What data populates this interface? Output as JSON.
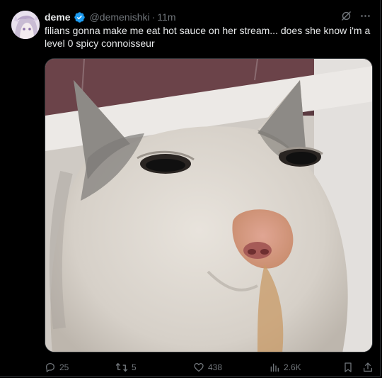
{
  "tweet": {
    "display_name": "deme",
    "handle": "@demenishki",
    "separator": "·",
    "timestamp": "11m",
    "text": "filians gonna make me eat hot sauce on her stream... does she know i'm a level 0 spicy connoisseur"
  },
  "actions": {
    "replies": "25",
    "reposts": "5",
    "likes": "438",
    "views": "2.6K"
  },
  "icons": {
    "verified": "verified-badge-icon",
    "grok": "grok-icon",
    "more": "more-icon",
    "reply": "reply-icon",
    "repost": "repost-icon",
    "like": "heart-icon",
    "views": "views-icon",
    "bookmark": "bookmark-icon",
    "share": "share-icon"
  },
  "colors": {
    "background": "#000000",
    "text_primary": "#e7e9ea",
    "text_secondary": "#71767b",
    "verified": "#1d9bf0",
    "border": "#2f3336"
  }
}
